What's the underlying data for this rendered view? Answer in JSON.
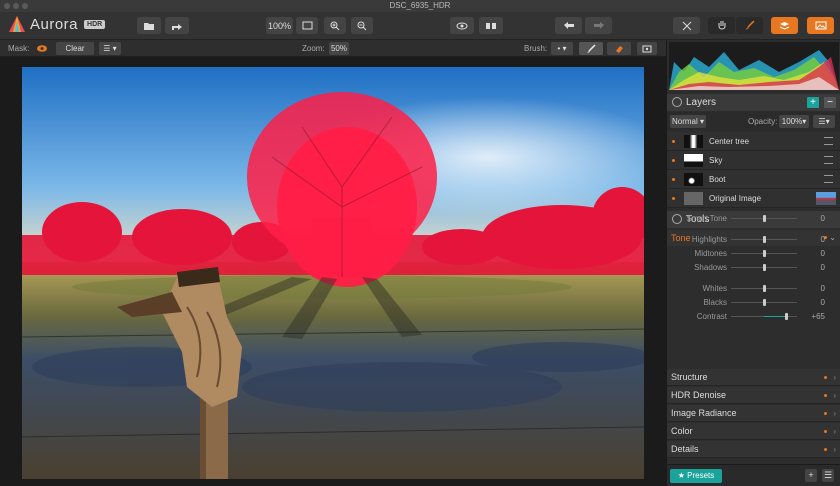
{
  "window": {
    "title": "DSC_6935_HDR"
  },
  "app": {
    "name": "Aurora",
    "badge": "HDR"
  },
  "toolbar": {
    "zoom_label": "100%",
    "icons": [
      "folder-open-icon",
      "share-icon",
      "fit-screen-icon",
      "zoom-in-icon",
      "zoom-out-icon",
      "preview-eye-icon",
      "compare-icon",
      "undo-icon",
      "redo-icon",
      "crop-icon",
      "hand-icon",
      "brush-icon",
      "layers-icon",
      "image-icon"
    ]
  },
  "subbar": {
    "mask_label": "Mask:",
    "clear_label": "Clear",
    "zoom_label": "Zoom:",
    "zoom_value": "50%",
    "brush_label": "Brush:"
  },
  "layers": {
    "title": "Layers",
    "blend_mode": "Normal",
    "opacity_label": "Opacity:",
    "opacity_value": "100%",
    "items": [
      {
        "name": "Center tree"
      },
      {
        "name": "Sky"
      },
      {
        "name": "Boot"
      },
      {
        "name": "Original Image"
      }
    ]
  },
  "tools": {
    "title": "Tools",
    "tone": {
      "title": "Tone",
      "sliders": [
        {
          "label": "Smart Tone",
          "value": "0",
          "level": 0.5
        },
        {
          "label": "Highlights",
          "value": "0",
          "level": 0.5
        },
        {
          "label": "Midtones",
          "value": "0",
          "level": 0.5
        },
        {
          "label": "Shadows",
          "value": "0",
          "level": 0.5
        },
        {
          "label": "Whites",
          "value": "0",
          "level": 0.5
        },
        {
          "label": "Blacks",
          "value": "0",
          "level": 0.5
        },
        {
          "label": "Contrast",
          "value": "+65",
          "level": 0.83
        }
      ]
    },
    "sections": [
      "Structure",
      "HDR Denoise",
      "Image Radiance",
      "Color",
      "Details"
    ]
  },
  "footer": {
    "presets_label": "Presets"
  },
  "colors": {
    "accent": "#e87722",
    "presets": "#1aa39a",
    "mask": "#ff1e46"
  }
}
